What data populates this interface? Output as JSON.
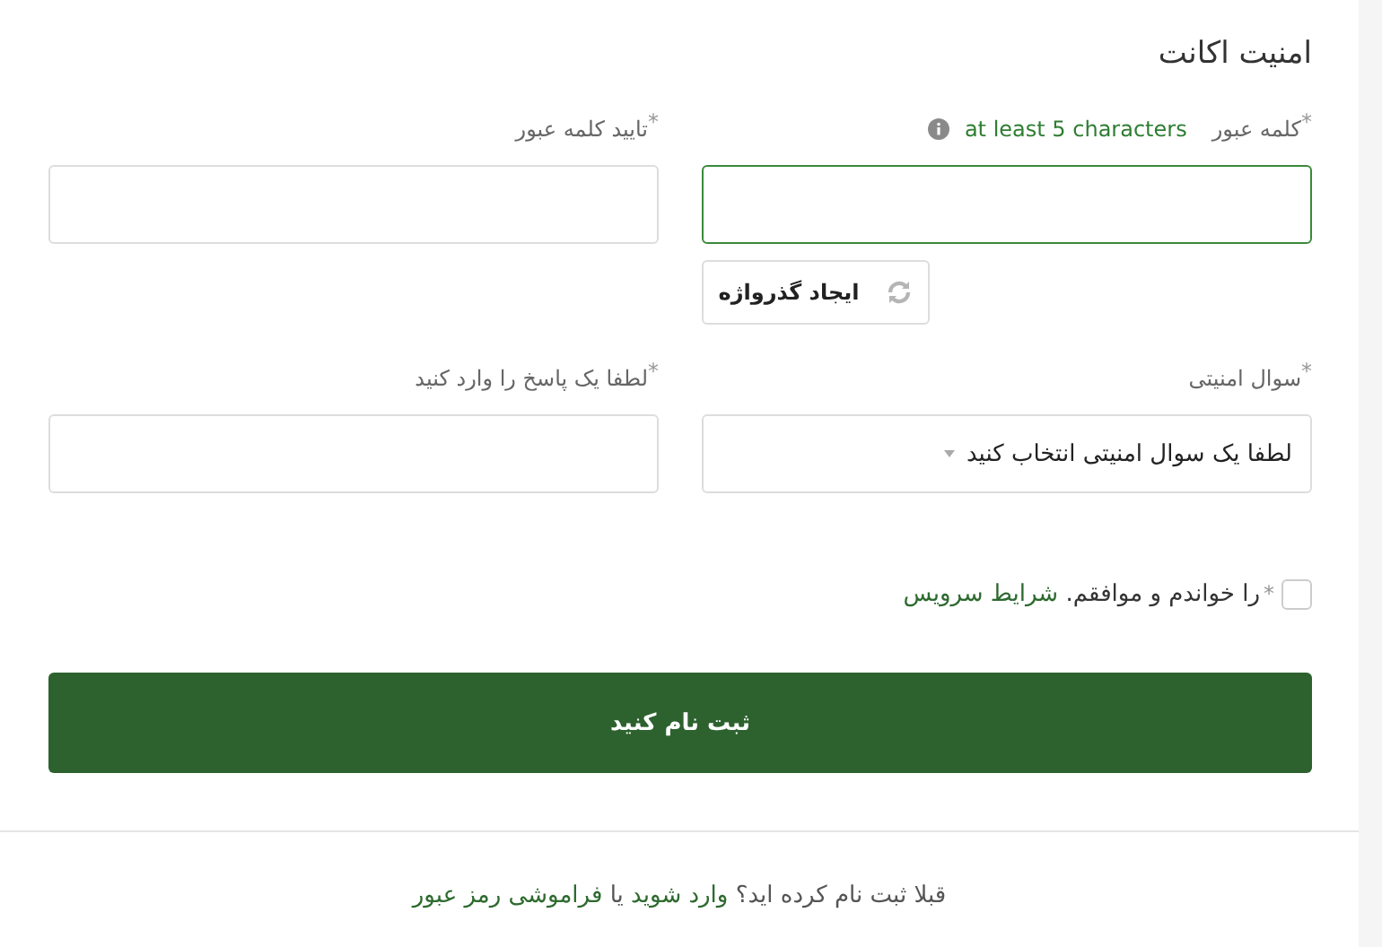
{
  "section_title": "امنیت اکانت",
  "fields": [
    {
      "kind": "password",
      "label": "کلمه عبور",
      "required_mark": "*",
      "hint": "at least 5 characters",
      "focused": true,
      "button": "ایجاد گذرواژه"
    },
    {
      "kind": "text",
      "label": "تایید کلمه عبور",
      "required_mark": "*",
      "focused": false
    },
    {
      "kind": "select",
      "label": "سوال امنیتی",
      "required_mark": "*",
      "value": "لطفا یک سوال امنیتی انتخاب کنید",
      "focused": false
    },
    {
      "kind": "text",
      "label": "لطفا یک پاسخ را وارد کنید",
      "required_mark": "*",
      "focused": false
    }
  ],
  "terms": {
    "checked": false,
    "required_mark": "*",
    "text": "را خواندم و موافقم.",
    "link": "شرایط سرویس"
  },
  "submit": "ثبت نام کنید",
  "footer": [
    {
      "kind": "text",
      "text": "قبلا ثبت نام کرده اید؟"
    },
    {
      "kind": "link",
      "text": "وارد شوید"
    },
    {
      "kind": "text",
      "text": "یا"
    },
    {
      "kind": "link",
      "text": "فراموشی رمز عبور"
    }
  ]
}
